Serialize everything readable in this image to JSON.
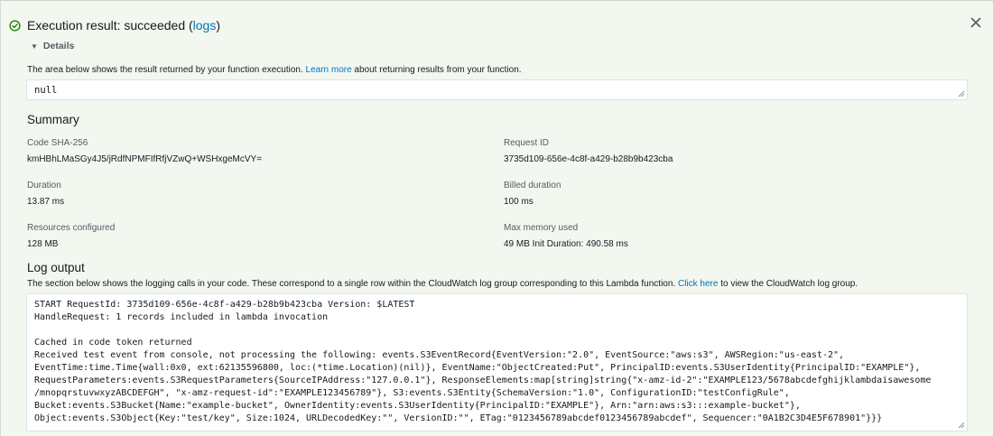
{
  "status": {
    "prefix": "Execution result: succeeded (",
    "logs_link": "logs",
    "suffix": ")"
  },
  "details_label": "Details",
  "result_section": {
    "desc_before": "The area below shows the result returned by your function execution. ",
    "learn_more": "Learn more",
    "desc_after": " about returning results from your function.",
    "value": "null"
  },
  "summary": {
    "heading": "Summary",
    "fields": [
      {
        "label": "Code SHA-256",
        "value": "kmHBhLMaSGy4J5/jRdfNPMFIfRfjVZwQ+WSHxgeMcVY="
      },
      {
        "label": "Request ID",
        "value": "3735d109-656e-4c8f-a429-b28b9b423cba"
      },
      {
        "label": "Duration",
        "value": "13.87 ms"
      },
      {
        "label": "Billed duration",
        "value": "100 ms"
      },
      {
        "label": "Resources configured",
        "value": "128 MB"
      },
      {
        "label": "Max memory used",
        "value": "49 MB Init Duration: 490.58 ms"
      }
    ]
  },
  "log_output": {
    "heading": "Log output",
    "desc_before": "The section below shows the logging calls in your code. These correspond to a single row within the CloudWatch log group corresponding to this Lambda function. ",
    "click_here": "Click here",
    "desc_after": " to view the CloudWatch log group.",
    "lines": [
      "START RequestId: 3735d109-656e-4c8f-a429-b28b9b423cba Version: $LATEST",
      "HandleRequest: 1 records included in lambda invocation",
      "",
      "Cached in code token returned",
      "Received test event from console, not processing the following: events.S3EventRecord{EventVersion:\"2.0\", EventSource:\"aws:s3\", AWSRegion:\"us-east-2\",",
      "EventTime:time.Time{wall:0x0, ext:62135596800, loc:(*time.Location)(nil)}, EventName:\"ObjectCreated:Put\", PrincipalID:events.S3UserIdentity{PrincipalID:\"EXAMPLE\"},",
      "RequestParameters:events.S3RequestParameters{SourceIPAddress:\"127.0.0.1\"}, ResponseElements:map[string]string{\"x-amz-id-2\":\"EXAMPLE123/5678abcdefghijklambdaisawesome",
      "/mnopqrstuvwxyzABCDEFGH\", \"x-amz-request-id\":\"EXAMPLE123456789\"}, S3:events.S3Entity{SchemaVersion:\"1.0\", ConfigurationID:\"testConfigRule\",",
      "Bucket:events.S3Bucket{Name:\"example-bucket\", OwnerIdentity:events.S3UserIdentity{PrincipalID:\"EXAMPLE\"}, Arn:\"arn:aws:s3:::example-bucket\"},",
      "Object:events.S3Object{Key:\"test/key\", Size:1024, URLDecodedKey:\"\", VersionID:\"\", ETag:\"0123456789abcdef0123456789abcdef\", Sequencer:\"0A1B2C3D4E5F678901\"}}}"
    ]
  },
  "colors": {
    "success": "#1d8102",
    "link": "#0073bb",
    "panel_bg": "#f2f8f0"
  },
  "icons": {
    "status": "check-circle-icon",
    "close": "close-icon",
    "caret": "caret-down-icon"
  }
}
